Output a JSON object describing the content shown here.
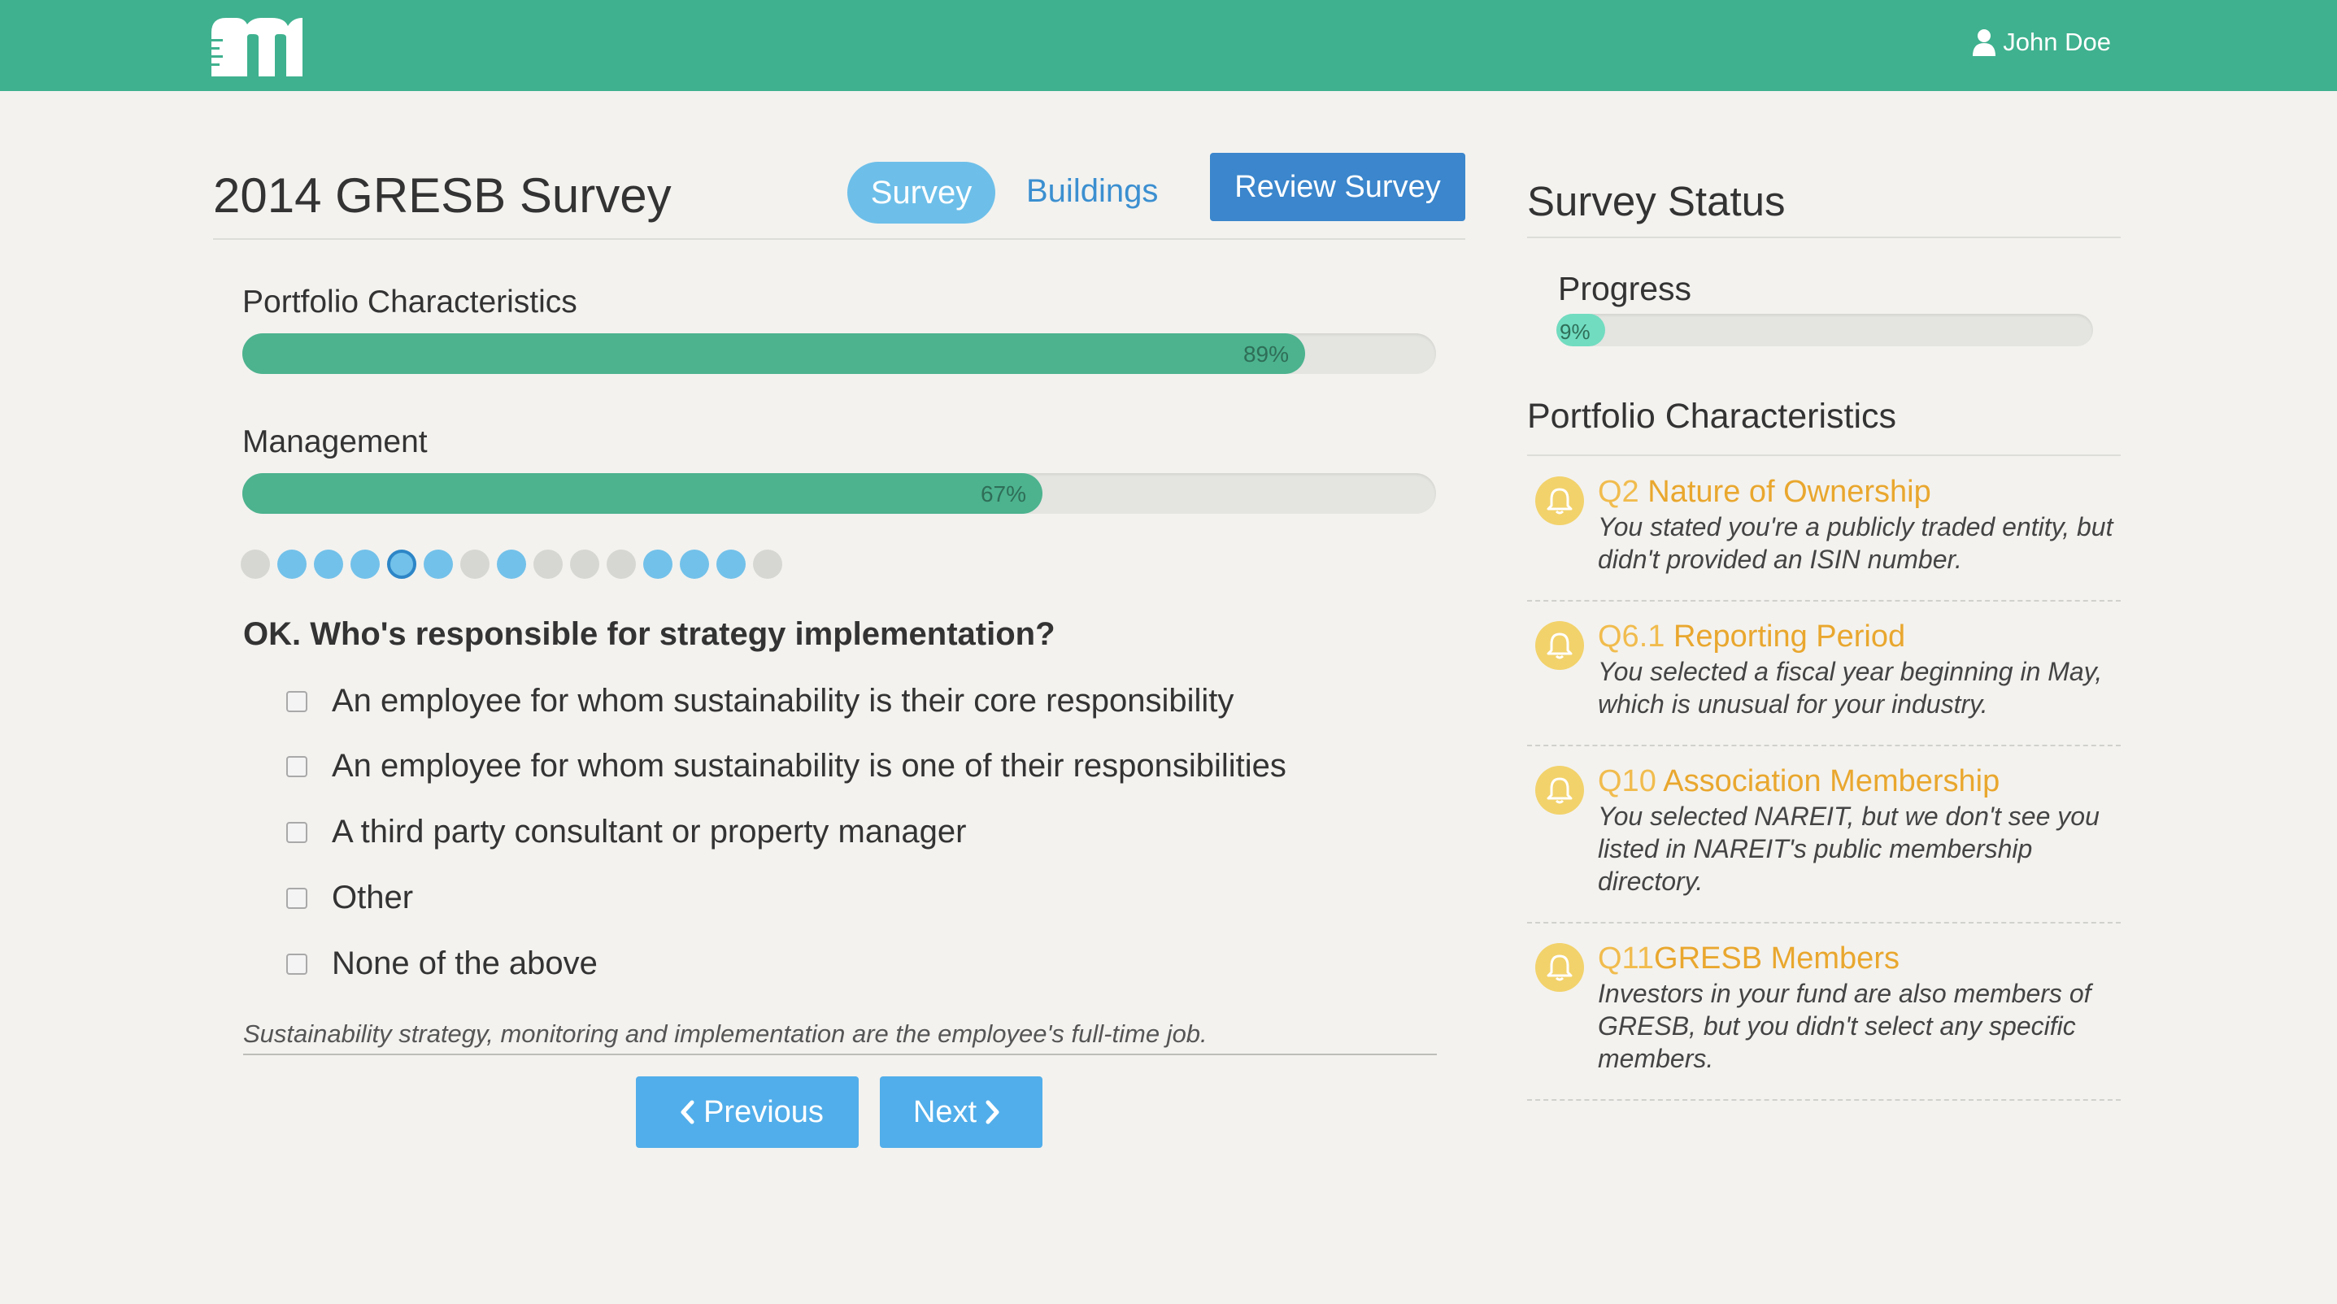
{
  "header": {
    "user_name": "John Doe",
    "logo_letter": "m"
  },
  "survey": {
    "title": "2014 GRESB Survey",
    "tabs": [
      {
        "label": "Survey",
        "active": true
      },
      {
        "label": "Buildings",
        "active": false
      }
    ],
    "review_button": "Review Survey"
  },
  "sections": [
    {
      "label": "Portfolio Characteristics",
      "progress_text": "89%",
      "progress": 0.89
    },
    {
      "label": "Management",
      "progress_text": "67%",
      "progress": 0.67
    }
  ],
  "question_dots": [
    "off",
    "on",
    "on",
    "on",
    "current",
    "on",
    "off",
    "on",
    "off",
    "off",
    "off",
    "on",
    "on",
    "on",
    "off"
  ],
  "question": {
    "text": "OK. Who's responsible for strategy implementation?",
    "options": [
      "An employee for whom sustainability is their core responsibility",
      "An employee for whom sustainability is one of their responsibilities",
      "A third party consultant or property manager",
      "Other",
      "None of the above"
    ],
    "help": "Sustainability strategy, monitoring and implementation are the employee's full-time job."
  },
  "nav": {
    "previous_label": "Previous",
    "next_label": "Next"
  },
  "status": {
    "title": "Survey Status",
    "progress_label": "Progress",
    "progress_text": "9%",
    "progress": 0.09,
    "section_heading": "Portfolio Characteristics",
    "alerts": [
      {
        "qnum": "Q2",
        "title": "Nature of Ownership",
        "text": "You stated you're a publicly traded entity, but didn't provided an ISIN number."
      },
      {
        "qnum": "Q6.1",
        "title": "Reporting Period",
        "text": "You selected a fiscal year beginning in May, which is unusual for your industry."
      },
      {
        "qnum": "Q10",
        "title": "Association Membership",
        "text": "You selected NAREIT, but we don't see you listed in NAREIT's public membership directory."
      },
      {
        "qnum": "Q11",
        "title": "GRESB Members",
        "text": "Investors in your fund are also members of GRESB, but you didn't select any specific members."
      }
    ]
  },
  "colors": {
    "brand_green": "#3fb18e",
    "progress_green": "#4cb38e",
    "accent_blue": "#3b86cc",
    "alert_orange": "#e9a72e"
  }
}
